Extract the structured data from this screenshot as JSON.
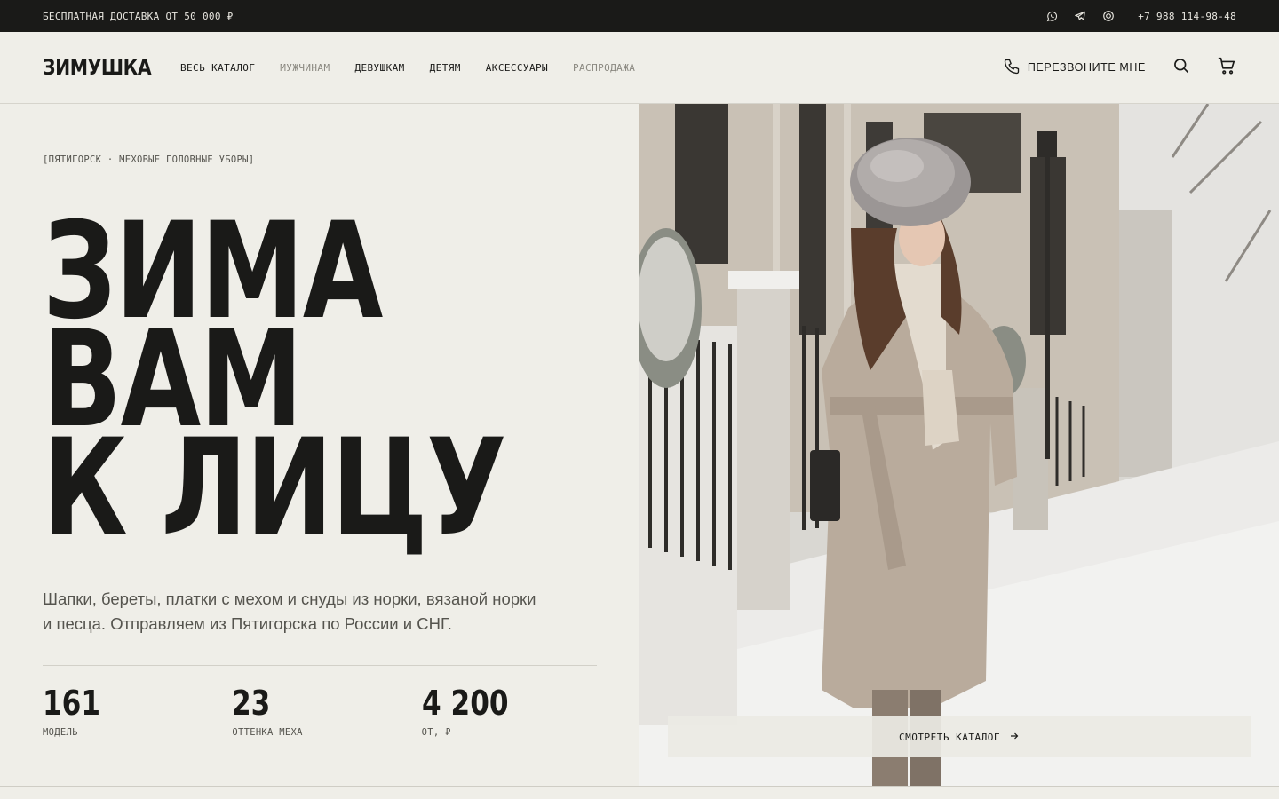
{
  "topbar": {
    "promo": "БЕСПЛАТНАЯ ДОСТАВКА ОТ 50 000 ₽",
    "phone": "+7 988 114-98-48",
    "social_icons": [
      "whatsapp-icon",
      "telegram-icon",
      "chat-icon"
    ]
  },
  "header": {
    "logo": "ЗИМУШКА",
    "nav": [
      {
        "label": "ВЕСЬ КАТАЛОГ"
      },
      {
        "label": "МУЖЧИНАМ"
      },
      {
        "label": "ДЕВУШКАМ"
      },
      {
        "label": "ДЕТЯМ"
      },
      {
        "label": "АКСЕССУАРЫ"
      },
      {
        "label": "РАСПРОДАЖА"
      }
    ],
    "callback": "ПЕРЕЗВОНИТЕ МНЕ"
  },
  "hero": {
    "eyebrow": "[ПЯТИГОРСК · МЕХОВЫЕ ГОЛОВНЫЕ УБОРЫ]",
    "headline": [
      "ЗИМА",
      "ВАМ",
      "К ЛИЦУ"
    ],
    "lead": "Шапки, береты, платки с мехом и снуды из норки, вязаной норки и песца. Отправляем из Пятигорска по России и СНГ.",
    "stats": [
      {
        "value": "161",
        "label": "МОДЕЛЬ"
      },
      {
        "value": "23",
        "label": "ОТТЕНКА МЕХА"
      },
      {
        "value": "4 200",
        "label": "ОТ, ₽"
      }
    ],
    "cta": "СМОТРЕТЬ КАТАЛОГ"
  },
  "colors": {
    "background": "#efeee8",
    "ink": "#1a1a18",
    "topbar": "#1a1a18",
    "muted": "#8a8880"
  }
}
